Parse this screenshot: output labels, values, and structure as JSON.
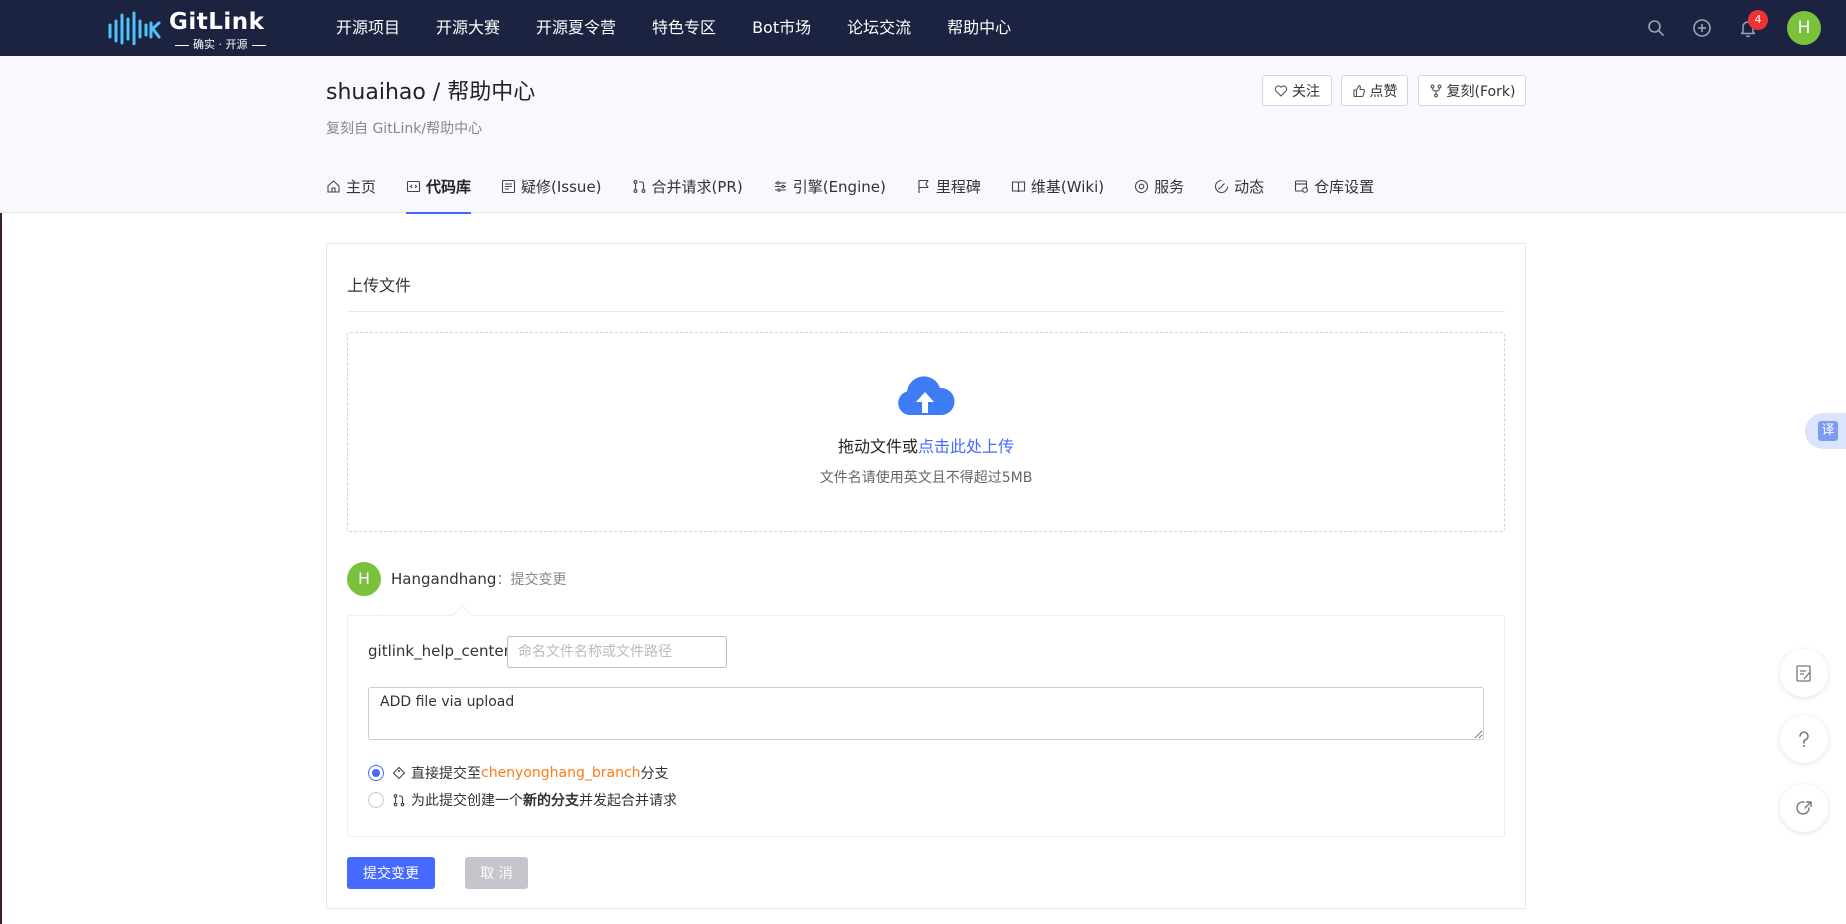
{
  "nav": {
    "brand": "GitLink",
    "slogan": "确实 · 开源",
    "menu": [
      "开源项目",
      "开源大赛",
      "开源夏令营",
      "特色专区",
      "Bot市场",
      "论坛交流",
      "帮助中心"
    ],
    "notifications": "4",
    "avatar": "H",
    "icons": [
      "search-icon",
      "plus-circle-icon",
      "bell-icon"
    ]
  },
  "repo": {
    "title": "shuaihao / 帮助中心",
    "forked_from": "复刻自 GitLink/帮助中心",
    "watch": "关注",
    "like": "点赞",
    "fork": "复刻(Fork)"
  },
  "tabs": [
    "主页",
    "代码库",
    "疑修(Issue)",
    "合并请求(PR)",
    "引擎(Engine)",
    "里程碑",
    "维基(Wiki)",
    "服务",
    "动态",
    "仓库设置"
  ],
  "active_tab": "代码库",
  "upload": {
    "title": "上传文件",
    "drop_text": "拖动文件或",
    "drop_link": "点击此处上传",
    "hint": "文件名请使用英文且不得超过5MB"
  },
  "commit": {
    "avatar": "H",
    "user": "Hangandhang",
    "action": "：提交变更",
    "path_prefix": "gitlink_help_center /",
    "path_placeholder": "命名文件名称或文件路径",
    "message": "ADD file via upload",
    "opt1_pre": "直接提交至",
    "opt1_branch": "chenyonghang_branch",
    "opt1_post": "分支",
    "opt2_pre": "为此提交创建一个",
    "opt2_bold": "新的分支",
    "opt2_post": "并发起合并请求",
    "submit": "提交变更",
    "cancel": "取 消"
  },
  "side": {
    "translate": "译",
    "accent": "#466aff"
  }
}
